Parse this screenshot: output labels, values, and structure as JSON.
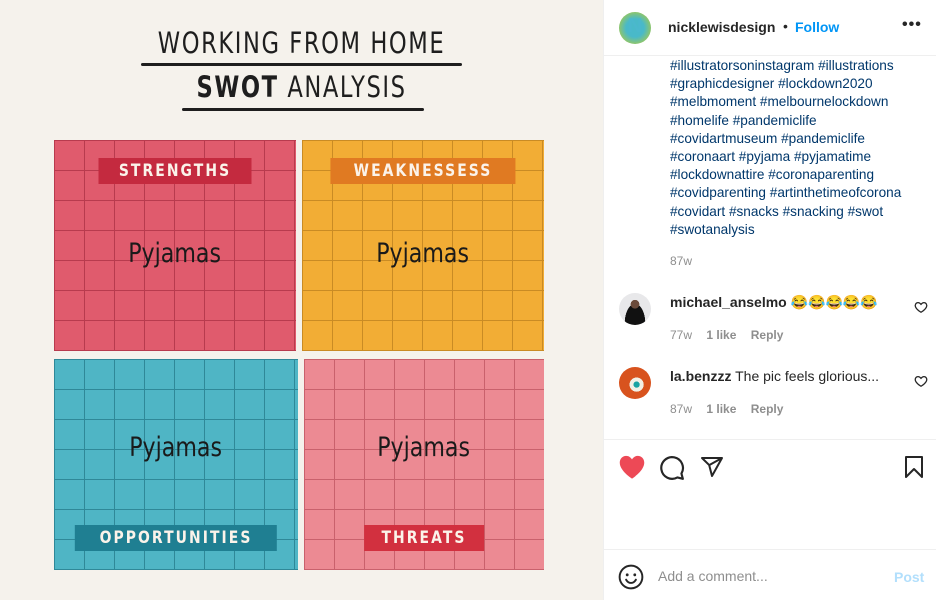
{
  "image": {
    "title_line1": "WORKING FROM HOME",
    "title_line2_bold": "SWOT",
    "title_line2_rest": " ANALYSIS",
    "quadrants": [
      {
        "label": "STRENGTHS",
        "content": "Pyjamas",
        "color": "#e05b6d"
      },
      {
        "label": "WEAKNESSESS",
        "content": "Pyjamas",
        "color": "#f2ad35"
      },
      {
        "label": "OPPORTUNITIES",
        "content": "Pyjamas",
        "color": "#4fb5c5"
      },
      {
        "label": "THREATS",
        "content": "Pyjamas",
        "color": "#ec8a93"
      }
    ]
  },
  "post": {
    "username": "nicklewisdesign",
    "separator": "•",
    "follow_label": "Follow",
    "more_label": "•••",
    "caption_lines": [
      "#illustratorsoninstagram #illustrations",
      "#graphicdesigner #lockdown2020",
      "#melbmoment #melbournelockdown",
      "#homelife #pandemiclife",
      "#covidartmuseum #pandemiclife",
      "#coronaart #pyjama #pyjamatime",
      "#lockdownattire #coronaparenting",
      "#covidparenting #artinthetimeofcorona",
      "#covidart #snacks #snacking #swot",
      "#swotanalysis"
    ],
    "caption_time": "87w",
    "liked": true,
    "accent_color": "#0095f6",
    "like_color": "#ed4956"
  },
  "comments": [
    {
      "username": "michael_anselmo",
      "text": " 😂😂😂😂😂",
      "time": "77w",
      "likes": "1 like",
      "reply": "Reply"
    },
    {
      "username": "la.benzzz",
      "text": " The pic feels glorious...",
      "time": "87w",
      "likes": "1 like",
      "reply": "Reply"
    }
  ],
  "composer": {
    "placeholder": "Add a comment...",
    "post_label": "Post"
  }
}
